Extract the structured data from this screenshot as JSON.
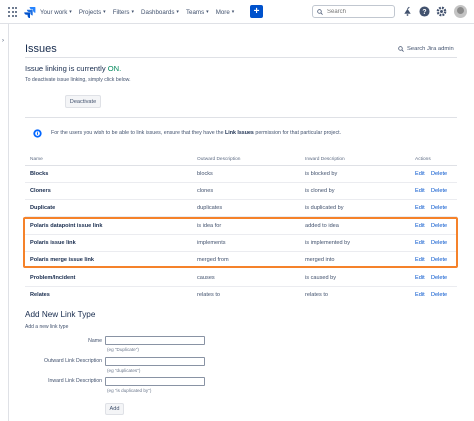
{
  "topnav": {
    "items": [
      {
        "label": "Your work"
      },
      {
        "label": "Projects"
      },
      {
        "label": "Filters"
      },
      {
        "label": "Dashboards"
      },
      {
        "label": "Teams"
      },
      {
        "label": "More"
      }
    ],
    "create_label": "+",
    "search_placeholder": "Search"
  },
  "page": {
    "title": "Issues",
    "admin_search": "Search Jira admin",
    "status_prefix": "Issue linking is currently",
    "status_value": "ON.",
    "deactivate_help": "To deactivate issue linking, simply click below.",
    "deactivate_label": "Deactivate",
    "info_before": "For the users you wish to be able to link issues, ensure that they have the",
    "info_bold": "Link Issues",
    "info_after": "permission for that particular project."
  },
  "table": {
    "headers": {
      "name": "Name",
      "outward": "Outward Description",
      "inward": "Inward Description",
      "actions": "Actions"
    },
    "rows": [
      {
        "name": "Blocks",
        "outward": "blocks",
        "inward": "is blocked by",
        "edit": "Edit",
        "delete": "Delete"
      },
      {
        "name": "Cloners",
        "outward": "clones",
        "inward": "is cloned by",
        "edit": "Edit",
        "delete": "Delete"
      },
      {
        "name": "Duplicate",
        "outward": "duplicates",
        "inward": "is duplicated by",
        "edit": "Edit",
        "delete": "Delete"
      },
      {
        "name": "Polaris datapoint issue link",
        "outward": "is idea for",
        "inward": "added to idea",
        "edit": "Edit",
        "delete": "Delete"
      },
      {
        "name": "Polaris issue link",
        "outward": "implements",
        "inward": "is implemented by",
        "edit": "Edit",
        "delete": "Delete"
      },
      {
        "name": "Polaris merge issue link",
        "outward": "merged from",
        "inward": "merged into",
        "edit": "Edit",
        "delete": "Delete"
      },
      {
        "name": "Problem/Incident",
        "outward": "causes",
        "inward": "is caused by",
        "edit": "Edit",
        "delete": "Delete"
      },
      {
        "name": "Relates",
        "outward": "relates to",
        "inward": "relates to",
        "edit": "Edit",
        "delete": "Delete"
      }
    ]
  },
  "add_form": {
    "title": "Add New Link Type",
    "subtitle": "Add a new link type",
    "name_label": "Name",
    "name_hint": "(eg \"Duplicate\")",
    "outward_label": "Outward Link Description",
    "outward_hint": "(eg \"duplicates\")",
    "inward_label": "Inward Link Description",
    "inward_hint": "(eg \"is duplicated by\")",
    "add_label": "Add"
  },
  "colors": {
    "accent": "#0052cc",
    "status_on": "#00875a",
    "highlight": "#f5822a"
  },
  "icons": [
    "apps-grid-icon",
    "jira-logo-icon",
    "search-icon",
    "notification-icon",
    "help-icon",
    "settings-icon",
    "info-icon",
    "chevron-right-icon"
  ]
}
